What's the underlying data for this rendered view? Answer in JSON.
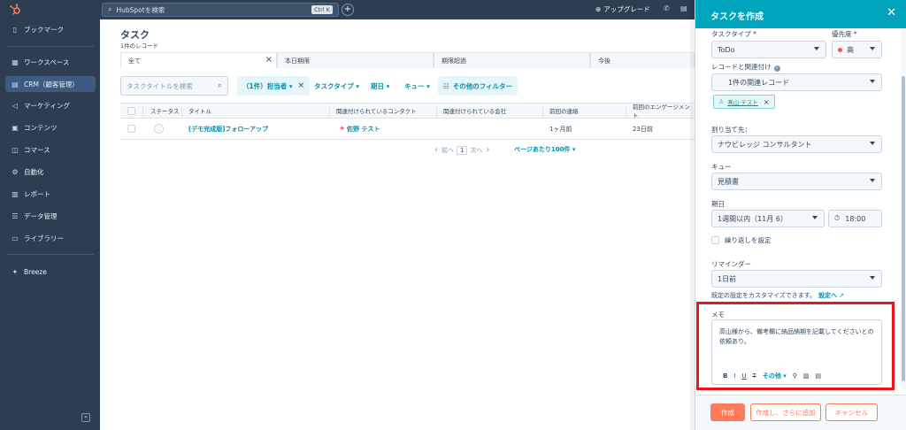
{
  "colors": {
    "sidebar": "#2d3e50",
    "accent": "#00a4bd",
    "link": "#0091ae",
    "primary_button": "#ff7a59",
    "highlight": "#e8161c"
  },
  "sidebar": {
    "items": [
      {
        "label": "ブックマーク",
        "icon": "bookmark-icon"
      },
      {
        "label": "ワークスペース",
        "icon": "workspace-icon"
      },
      {
        "label": "CRM（顧客管理）",
        "icon": "crm-icon"
      },
      {
        "label": "マーケティング",
        "icon": "marketing-icon"
      },
      {
        "label": "コンテンツ",
        "icon": "content-icon"
      },
      {
        "label": "コマース",
        "icon": "commerce-icon"
      },
      {
        "label": "自動化",
        "icon": "automation-icon"
      },
      {
        "label": "レポート",
        "icon": "report-icon"
      },
      {
        "label": "データ管理",
        "icon": "data-icon"
      },
      {
        "label": "ライブラリー",
        "icon": "library-icon"
      },
      {
        "label": "Breeze",
        "icon": "breeze-icon"
      }
    ],
    "collapse_glyph": "«"
  },
  "topbar": {
    "search_placeholder": "HubSpotを検索",
    "shortcut": "Ctrl K",
    "plus": "+",
    "upgrade": "アップグレード"
  },
  "main": {
    "title": "タスク",
    "subtitle": "1件のレコード",
    "tabs": [
      "全て",
      "本日期限",
      "期限超過",
      "今後"
    ],
    "tab_close": "×",
    "search_placeholder": "タスクタイトルを検索",
    "filters": {
      "owner": "（1件）担当者 ▾",
      "task_type": "タスクタイプ ▾",
      "due": "期日 ▾",
      "queue": "キュー ▾",
      "more": "その他のフィルター"
    },
    "columns": [
      "ステータス",
      "タイトル",
      "関連付けられているコンタクト",
      "関連付けられている会社",
      "前回の連絡",
      "前回のエンゲージメント"
    ],
    "rows": [
      {
        "status": "○",
        "title": "[デモ完成版]フォローアップ",
        "contact": "佐野 テスト",
        "company": "",
        "last_contact": "1ヶ月前",
        "last_engagement": "23日前"
      }
    ],
    "pager": {
      "prev": "前へ",
      "page": "1",
      "next": "次へ",
      "per_page": "ページあたり100件 ▾"
    }
  },
  "panel": {
    "title": "タスクを作成",
    "task_type_label": "タスクタイプ",
    "task_type_value": "ToDo",
    "priority_label": "優先度",
    "priority_value": "高",
    "assoc_label": "レコードと関連付け",
    "assoc_value": "1件の関連レコード",
    "assoc_chip": "髙山 テスト",
    "assign_label": "割り当て先：",
    "assign_value": "ナウビレッジ コンサルタント",
    "queue_label": "キュー",
    "queue_value": "見積書",
    "due_label": "期日",
    "due_value": "1週間以内（11月 6）",
    "time_value": "18:00",
    "repeat_label": "繰り返しを設定",
    "reminder_label": "リマインダー",
    "reminder_value": "1日前",
    "custom_note": "既定の設定をカスタマイズできます。",
    "custom_link": "設定へ",
    "memo_label": "メモ",
    "memo_text": "高山様から、備考欄に納品納期を記載してくださいとの依頼あり。",
    "memo_tools": {
      "bold": "B",
      "italic": "I",
      "underline": "U",
      "clear": "T",
      "more": "その他 ▾"
    },
    "buttons": {
      "create": "作成",
      "create_add": "作成し、さらに追加",
      "cancel": "キャンセル"
    },
    "required_mark": "*",
    "info": "i"
  }
}
